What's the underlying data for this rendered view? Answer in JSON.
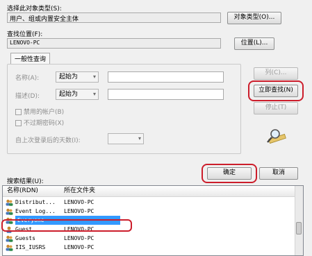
{
  "object_type": {
    "label": "选择此对象类型(S):",
    "value": "用户、组或内置安全主体",
    "button": "对象类型(O)..."
  },
  "location": {
    "label": "查找位置(F):",
    "value": "LENOVO-PC",
    "button": "位置(L)..."
  },
  "general_query": {
    "tab": "一般性查询",
    "name_label": "名称(A):",
    "name_mode": "起始为",
    "desc_label": "描述(D):",
    "desc_mode": "起始为",
    "disabled_accounts": "禁用的帐户(B)",
    "no_expire_password": "不过期密码(X)",
    "days_since_login": "自上次登录后的天数(I):"
  },
  "side_buttons": {
    "columns": "列(C)...",
    "find_now": "立即查找(N)",
    "stop": "停止(T)"
  },
  "dialog_buttons": {
    "ok": "确定",
    "cancel": "取消"
  },
  "results": {
    "label": "搜索结果(U):",
    "columns": [
      "名称(RDN)",
      "所在文件夹"
    ],
    "rows": [
      {
        "name": "Distribut...",
        "folder": "LENOVO-PC"
      },
      {
        "name": "Event Log...",
        "folder": "LENOVO-PC"
      },
      {
        "name": "Everyone",
        "folder": ""
      },
      {
        "name": "Guest",
        "folder": "LENOVO-PC"
      },
      {
        "name": "Guests",
        "folder": "LENOVO-PC"
      },
      {
        "name": "IIS_IUSRS",
        "folder": "LENOVO-PC"
      }
    ]
  }
}
